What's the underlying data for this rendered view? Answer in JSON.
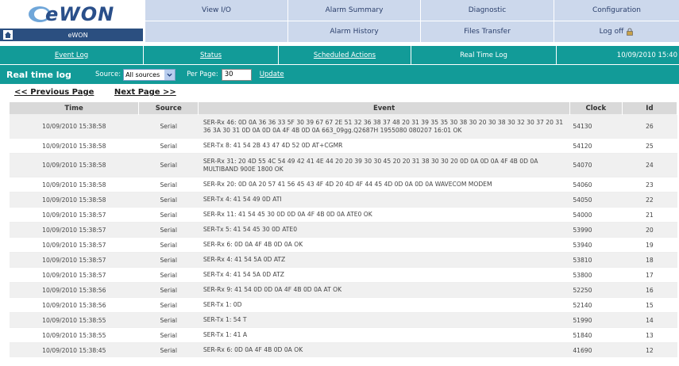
{
  "brand": {
    "logo_text": "eWON",
    "device_name": "eWON"
  },
  "nav": {
    "row1": [
      "View I/O",
      "Alarm Summary",
      "Diagnostic",
      "Configuration"
    ],
    "row2": [
      "",
      "Alarm History",
      "Files Transfer",
      "Log off"
    ]
  },
  "subnav": {
    "event_log": "Event Log",
    "status": "Status",
    "scheduled_actions": "Scheduled Actions",
    "real_time_log": "Real Time Log",
    "datetime": "10/09/2010 15:40"
  },
  "toolbar": {
    "title": "Real time log",
    "source_label": "Source:",
    "source_value": "All sources",
    "per_page_label": "Per Page:",
    "per_page_value": "30",
    "update_label": "Update"
  },
  "paging": {
    "prev": "<< Previous Page",
    "next": "Next Page >>"
  },
  "table": {
    "headers": {
      "time": "Time",
      "source": "Source",
      "event": "Event",
      "clock": "Clock",
      "id": "Id"
    },
    "rows": [
      {
        "time": "10/09/2010 15:38:58",
        "source": "Serial",
        "event": "SER-Rx 46: 0D 0A 36 36 33 5F 30 39 67 67 2E 51 32 36 38 37 48 20 31 39 35 35 30 38 30 20 30 38 30 32 30 37 20 31 36 3A 30 31 0D 0A 0D 0A 4F 4B 0D 0A 663_09gg.Q2687H 1955080 080207 16:01 OK",
        "clock": "54130",
        "id": "26"
      },
      {
        "time": "10/09/2010 15:38:58",
        "source": "Serial",
        "event": "SER-Tx 8: 41 54 2B 43 47 4D 52 0D AT+CGMR",
        "clock": "54120",
        "id": "25"
      },
      {
        "time": "10/09/2010 15:38:58",
        "source": "Serial",
        "event": "SER-Rx 31: 20 4D 55 4C 54 49 42 41 4E 44 20 20 39 30 30 45 20 20 31 38 30 30 20 0D 0A 0D 0A 4F 4B 0D 0A MULTIBAND 900E 1800 OK",
        "clock": "54070",
        "id": "24"
      },
      {
        "time": "10/09/2010 15:38:58",
        "source": "Serial",
        "event": "SER-Rx 20: 0D 0A 20 57 41 56 45 43 4F 4D 20 4D 4F 44 45 4D 0D 0A 0D 0A WAVECOM MODEM",
        "clock": "54060",
        "id": "23"
      },
      {
        "time": "10/09/2010 15:38:58",
        "source": "Serial",
        "event": "SER-Tx 4: 41 54 49 0D ATI",
        "clock": "54050",
        "id": "22"
      },
      {
        "time": "10/09/2010 15:38:57",
        "source": "Serial",
        "event": "SER-Rx 11: 41 54 45 30 0D 0D 0A 4F 4B 0D 0A ATE0 OK",
        "clock": "54000",
        "id": "21"
      },
      {
        "time": "10/09/2010 15:38:57",
        "source": "Serial",
        "event": "SER-Tx 5: 41 54 45 30 0D ATE0",
        "clock": "53990",
        "id": "20"
      },
      {
        "time": "10/09/2010 15:38:57",
        "source": "Serial",
        "event": "SER-Rx 6: 0D 0A 4F 4B 0D 0A OK",
        "clock": "53940",
        "id": "19"
      },
      {
        "time": "10/09/2010 15:38:57",
        "source": "Serial",
        "event": "SER-Rx 4: 41 54 5A 0D ATZ",
        "clock": "53810",
        "id": "18"
      },
      {
        "time": "10/09/2010 15:38:57",
        "source": "Serial",
        "event": "SER-Tx 4: 41 54 5A 0D ATZ",
        "clock": "53800",
        "id": "17"
      },
      {
        "time": "10/09/2010 15:38:56",
        "source": "Serial",
        "event": "SER-Rx 9: 41 54 0D 0D 0A 4F 4B 0D 0A AT OK",
        "clock": "52250",
        "id": "16"
      },
      {
        "time": "10/09/2010 15:38:56",
        "source": "Serial",
        "event": "SER-Tx 1: 0D",
        "clock": "52140",
        "id": "15"
      },
      {
        "time": "10/09/2010 15:38:55",
        "source": "Serial",
        "event": "SER-Tx 1: 54 T",
        "clock": "51990",
        "id": "14"
      },
      {
        "time": "10/09/2010 15:38:55",
        "source": "Serial",
        "event": "SER-Tx 1: 41 A",
        "clock": "51840",
        "id": "13"
      },
      {
        "time": "10/09/2010 15:38:45",
        "source": "Serial",
        "event": "SER-Rx 6: 0D 0A 4F 4B 0D 0A OK",
        "clock": "41690",
        "id": "12"
      }
    ]
  },
  "colors": {
    "teal": "#129b98",
    "nav_bg": "#ccd8ec",
    "brand_blue": "#2b4f80"
  }
}
